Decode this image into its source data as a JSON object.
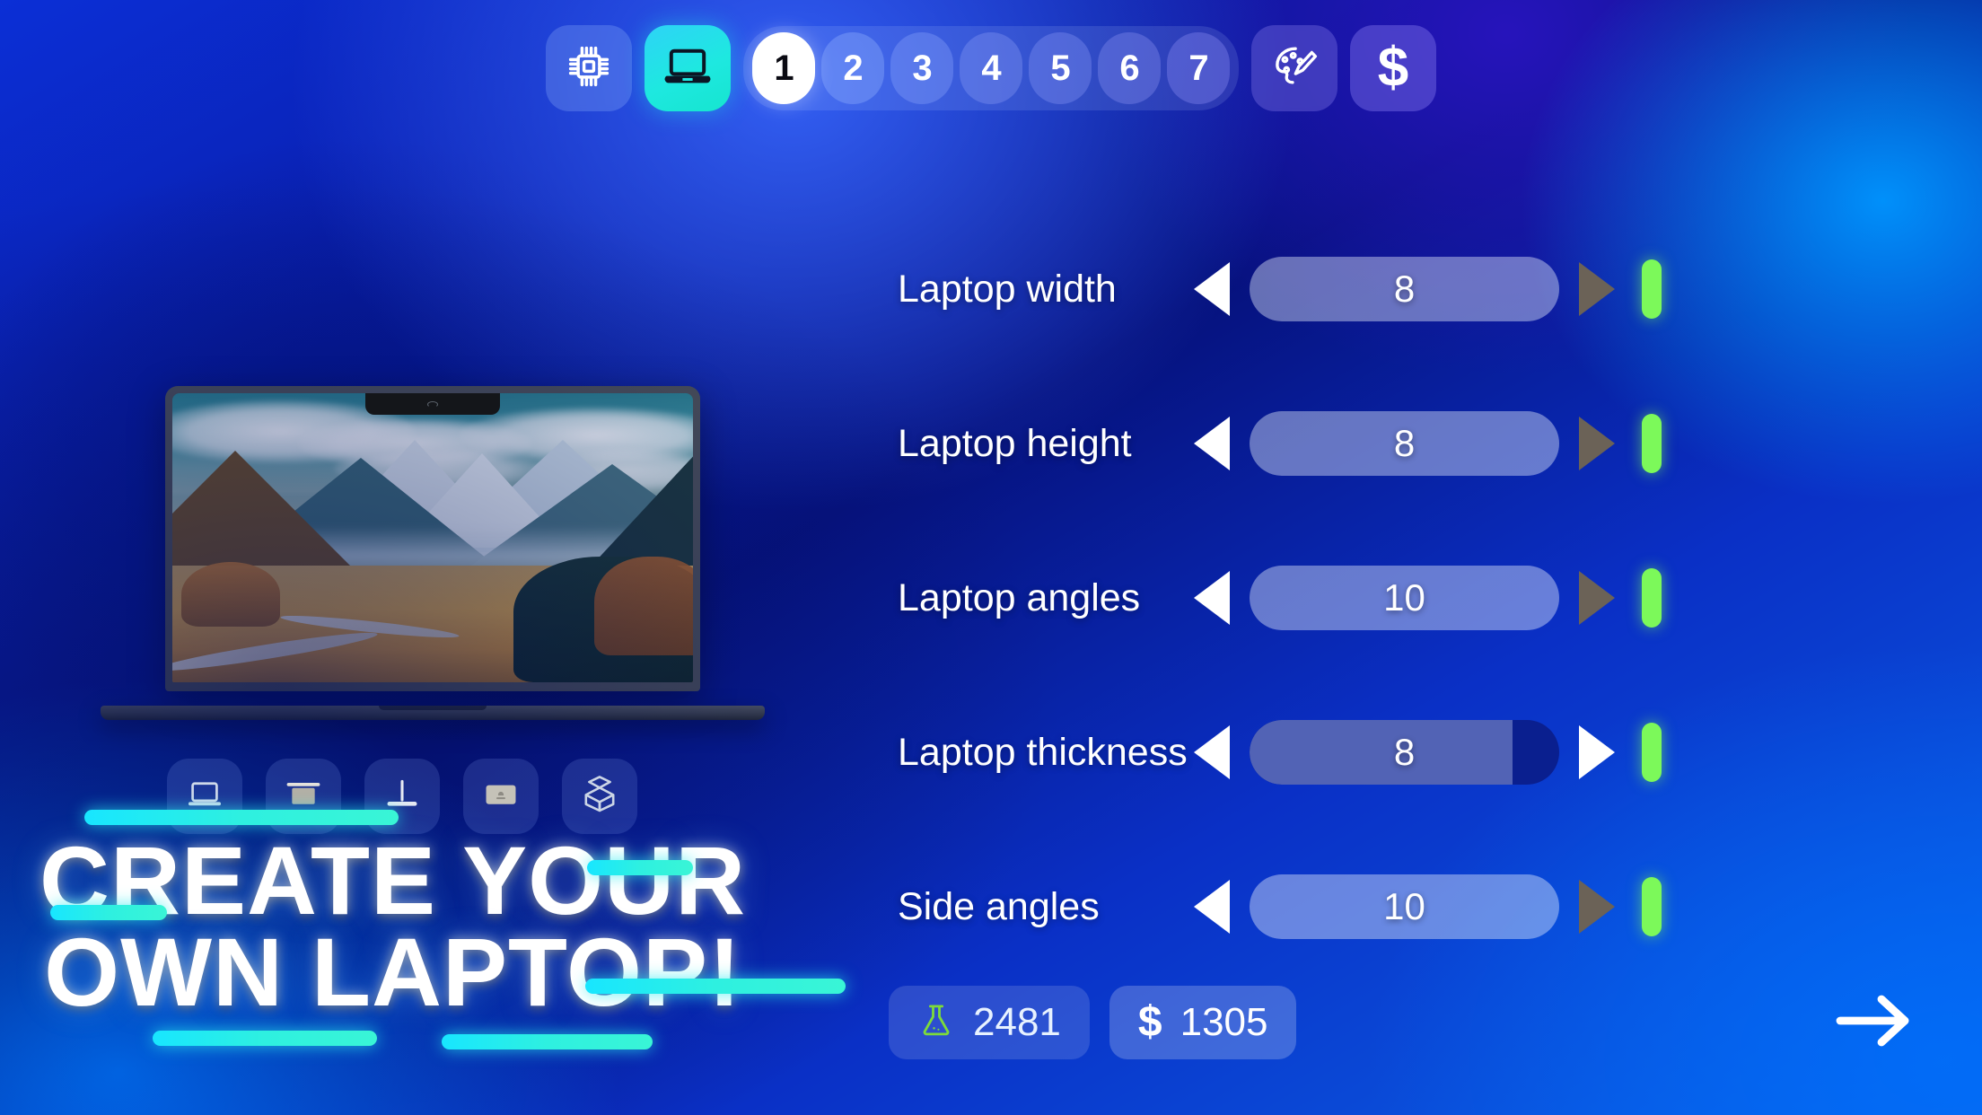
{
  "toolbar": {
    "chip_button": {
      "name": "chip-icon",
      "label": ""
    },
    "laptop_tab": {
      "name": "laptop-icon",
      "label": "",
      "active": true
    },
    "numbers": [
      {
        "label": "1",
        "active": true
      },
      {
        "label": "2",
        "active": false
      },
      {
        "label": "3",
        "active": false
      },
      {
        "label": "4",
        "active": false
      },
      {
        "label": "5",
        "active": false
      },
      {
        "label": "6",
        "active": false
      },
      {
        "label": "7",
        "active": false
      }
    ],
    "palette_button": {
      "name": "palette-icon",
      "label": ""
    },
    "money_button": {
      "name": "dollar-icon",
      "label": "$"
    }
  },
  "preview": {
    "wallpaper_description": "mountain valley landscape with winding road",
    "parts": [
      {
        "name": "laptop-icon",
        "label": ""
      },
      {
        "name": "screen-icon",
        "label": ""
      },
      {
        "name": "hinge-icon",
        "label": ""
      },
      {
        "name": "trackpad-icon",
        "label": ""
      },
      {
        "name": "box-icon",
        "label": ""
      }
    ]
  },
  "headline": {
    "line1": "CREATE YOUR",
    "line2": "OWN LAPTOP!"
  },
  "sliders": {
    "rows": [
      {
        "label": "Laptop width",
        "value": "8",
        "fill_percent": 100,
        "right_enabled": false
      },
      {
        "label": "Laptop height",
        "value": "8",
        "fill_percent": 100,
        "right_enabled": false
      },
      {
        "label": "Laptop angles",
        "value": "10",
        "fill_percent": 100,
        "right_enabled": false
      },
      {
        "label": "Laptop thickness",
        "value": "8",
        "fill_percent": 85,
        "right_enabled": true
      },
      {
        "label": "Side angles",
        "value": "10",
        "fill_percent": 100,
        "right_enabled": false
      }
    ],
    "left_arrow_name": "decrease-arrow",
    "right_arrow_name": "increase-arrow",
    "indicator_name": "value-indicator"
  },
  "stats": {
    "research": {
      "icon": "flask-icon",
      "value": "2481"
    },
    "money": {
      "icon": "dollar-icon",
      "value": "1305",
      "symbol": "$"
    }
  },
  "next_button": {
    "name": "next-arrow-icon",
    "label": ""
  },
  "colors": {
    "accent_cyan": "#1ee8e0",
    "indicator_green": "#7cf95a",
    "arrow_disabled": "#6b6257",
    "bg_blue_dark": "#06127e",
    "bg_blue_light": "#0a63e8"
  }
}
